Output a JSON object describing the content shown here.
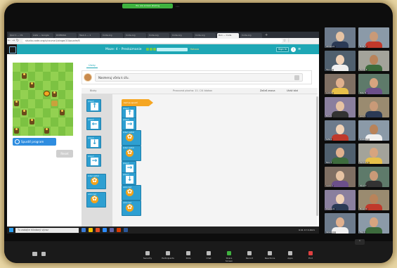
{
  "meeting": {
    "sharing_pill": "You are screen sharing",
    "pill_extra": "•••"
  },
  "browser": {
    "tabs": [
      "Quiz 1 — CS",
      "Lista — Google",
      "DOPRAVA",
      "Task A — 1",
      "Code.org",
      "Code.org",
      "Code.org",
      "Code.org",
      "Code.org",
      "Run — Code",
      "Code.org"
    ],
    "active_tab_index": 9,
    "url": "studio.code.org/s/course1/stage/10/puzzle/6",
    "new_tab": "+"
  },
  "app": {
    "title": "Maze: 4 – Preskúmanie",
    "finish_label": "Hotovo",
    "signin_label": "Sign In",
    "run_label": "Spustiť program",
    "reset_label": "Reset",
    "instructions_tab": "Úlohy",
    "instruction_text": "Nasmeruj včelu k úľu."
  },
  "workspace_header": {
    "toolbox_label": "Bloky",
    "center_label": "Pracovná plocha: 11 / 24 blokov",
    "start_over": "Začať znova",
    "show_code": "Ukáž kód"
  },
  "toolbox_blocks": [
    {
      "label": "presuň",
      "glyph": "↑",
      "type": "move"
    },
    {
      "label": "presuň",
      "glyph": "←",
      "type": "move"
    },
    {
      "label": "presuň",
      "glyph": "↓",
      "type": "move"
    },
    {
      "label": "presuň",
      "glyph": "→",
      "type": "move"
    },
    {
      "label": "zober nektár",
      "glyph": "✿",
      "type": "action"
    },
    {
      "label": "urob med",
      "glyph": "✿",
      "type": "action"
    }
  ],
  "program": {
    "start_label": "keď sa spustí",
    "blocks": [
      {
        "label": "presuň",
        "glyph": "↑",
        "type": "move"
      },
      {
        "label": "presuň",
        "glyph": "→",
        "type": "move"
      },
      {
        "label": "zober nektár",
        "glyph": "✿",
        "type": "action"
      },
      {
        "label": "zober nektár",
        "glyph": "✿",
        "type": "action"
      },
      {
        "label": "presuň",
        "glyph": "→",
        "type": "move"
      },
      {
        "label": "presuň",
        "glyph": "↓",
        "type": "move"
      },
      {
        "label": "urob med",
        "glyph": "✿",
        "type": "action"
      },
      {
        "label": "urob med",
        "glyph": "✿",
        "type": "action"
      }
    ]
  },
  "taskbar": {
    "search_placeholder": "Tu zadajte hľadaný výraz",
    "clock": "9:41",
    "date": "17.3.2021"
  },
  "participants": [
    {
      "name": "Adriana K."
    },
    {
      "name": "Matej P."
    },
    {
      "name": "Hana S."
    },
    {
      "name": "Tomáš R."
    },
    {
      "name": "Lucia M."
    },
    {
      "name": "Peter B."
    },
    {
      "name": "Ema D."
    },
    {
      "name": "Juraj V."
    },
    {
      "name": "Sofia L."
    },
    {
      "name": "Kristián H."
    },
    {
      "name": "Nina T."
    },
    {
      "name": "Samuel G."
    },
    {
      "name": "Laura C."
    },
    {
      "name": "Dávid F."
    },
    {
      "name": "Zuzana O."
    },
    {
      "name": "Marek N."
    },
    {
      "name": "Veronika J."
    },
    {
      "name": "Filip A."
    }
  ],
  "zoom_toolbar": [
    {
      "label": "Security"
    },
    {
      "label": "Participants"
    },
    {
      "label": "Polls"
    },
    {
      "label": "Chat"
    },
    {
      "label": "Share Screen"
    },
    {
      "label": "Record"
    },
    {
      "label": "Reactions"
    },
    {
      "label": "Apps"
    },
    {
      "label": "End"
    }
  ],
  "colors": {
    "accent": "#1ea7b5",
    "block_blue": "#2e9fd1",
    "block_orange": "#f5a623",
    "grass": "#7cc242"
  }
}
